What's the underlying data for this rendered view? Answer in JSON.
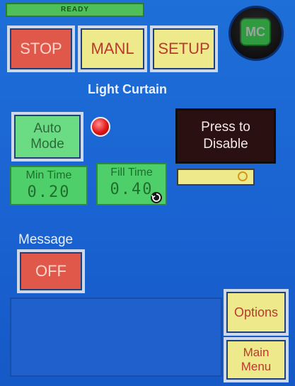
{
  "status": {
    "text": "READY"
  },
  "top_buttons": {
    "stop": "STOP",
    "manl": "MANL",
    "setup": "SETUP"
  },
  "mc": {
    "label": "MC"
  },
  "section": {
    "title": "Light Curtain"
  },
  "auto_mode": {
    "line1": "Auto",
    "line2": "Mode"
  },
  "disable": {
    "line1": "Press to",
    "line2": "Disable"
  },
  "min_time": {
    "label": "Min Time",
    "value": "0.20"
  },
  "fill_time": {
    "label": "Fill Time",
    "value": "0.40"
  },
  "message": {
    "label": "Message",
    "button": "OFF"
  },
  "side_buttons": {
    "options": "Options",
    "main_menu_line1": "Main",
    "main_menu_line2": "Menu"
  },
  "icons": {
    "indicator": "red-indicator-icon",
    "reset": "reset-icon"
  },
  "colors": {
    "background": "#1e6fd8",
    "red": "#e0584a",
    "yellow": "#eee98a",
    "green": "#4fcf6a"
  }
}
